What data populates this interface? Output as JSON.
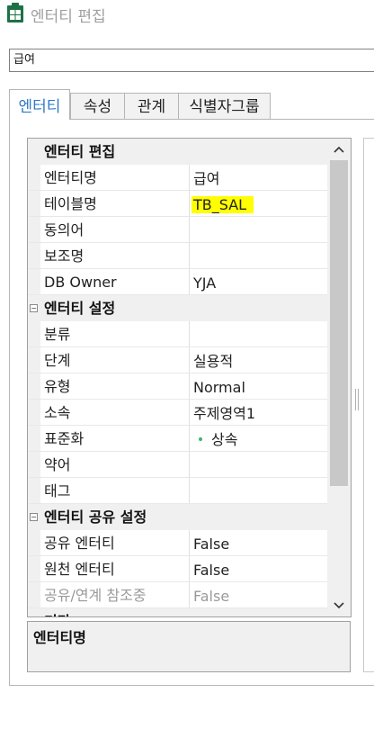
{
  "window": {
    "title": "엔터티 편집",
    "app_icon": "excel-table-icon"
  },
  "entity_name_field": {
    "value": "급여"
  },
  "tabs": [
    {
      "label": "엔터티",
      "active": true
    },
    {
      "label": "속성"
    },
    {
      "label": "관계"
    },
    {
      "label": "식별자그룹"
    }
  ],
  "property_grid": {
    "categories": [
      {
        "label": "엔터티 편집",
        "rows": [
          {
            "name": "엔터티명",
            "value": "급여"
          },
          {
            "name": "테이블명",
            "value": "TB_SAL",
            "highlight_color": "#ffff00"
          },
          {
            "name": "동의어",
            "value": ""
          },
          {
            "name": "보조명",
            "value": ""
          },
          {
            "name": "DB Owner",
            "value": "YJA"
          }
        ]
      },
      {
        "label": "엔터티 설정",
        "collapse_icon": "minus-box-icon",
        "rows": [
          {
            "name": "분류",
            "value": ""
          },
          {
            "name": "단계",
            "value": "실용적"
          },
          {
            "name": "유형",
            "value": "Normal"
          },
          {
            "name": "소속",
            "value": "주제영역1"
          },
          {
            "name": "표준화",
            "value": "상속",
            "bullet_color": "#3cb371"
          },
          {
            "name": "약어",
            "value": ""
          },
          {
            "name": "태그",
            "value": ""
          }
        ]
      },
      {
        "label": "엔터티 공유 설정",
        "collapse_icon": "minus-box-icon",
        "rows": [
          {
            "name": "공유 엔터티",
            "value": "False"
          },
          {
            "name": "원천 엔터티",
            "value": "False"
          },
          {
            "name": "공유/연계 참조중",
            "value": "False",
            "disabled": true
          }
        ]
      },
      {
        "label": "기타",
        "collapse_icon": "minus-box-icon"
      }
    ]
  },
  "description_panel": {
    "title": "엔터티명"
  },
  "colors": {
    "active_tab_text": "#2f78c8",
    "highlight": "#ffff00",
    "grid_background": "#f0f0f0"
  }
}
